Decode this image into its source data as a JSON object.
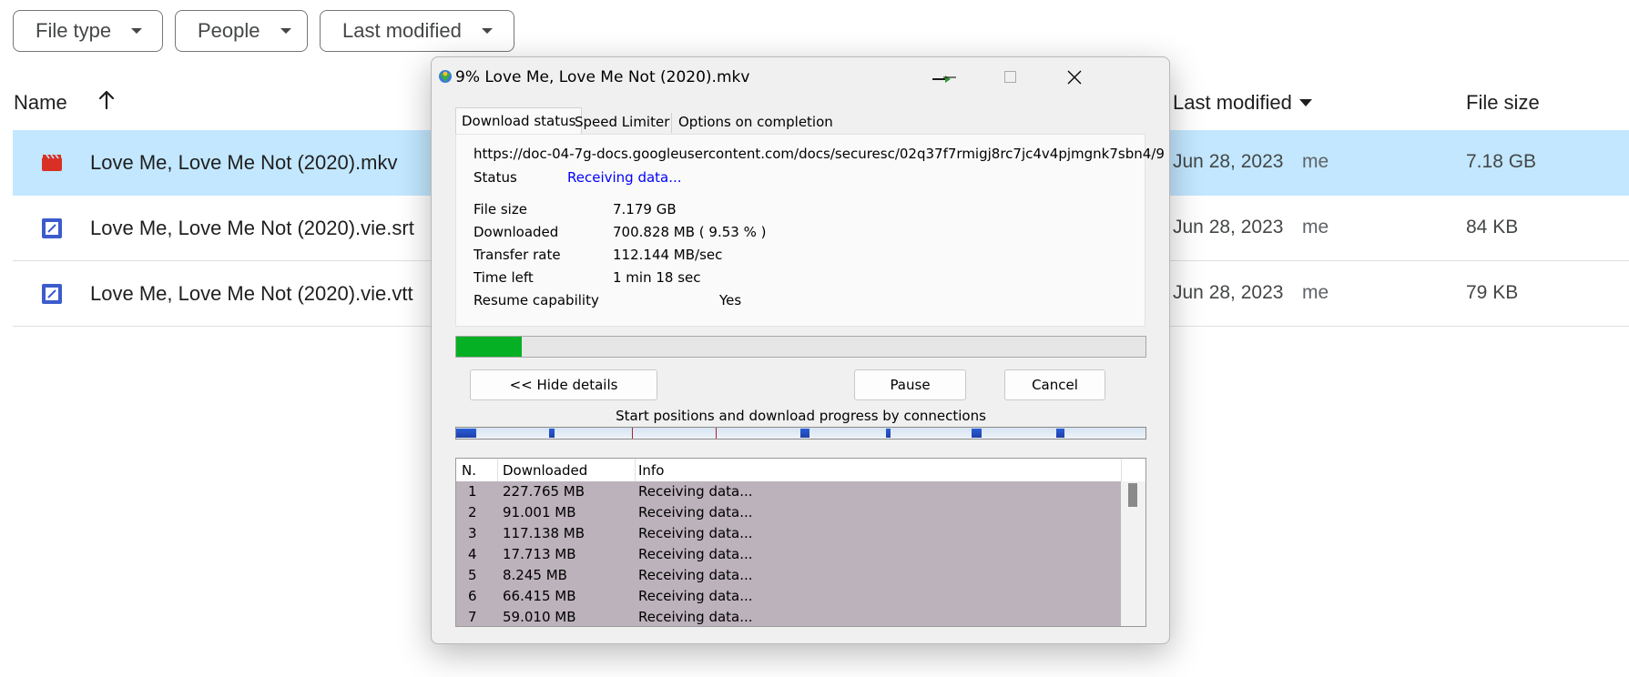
{
  "drive": {
    "filters": [
      "File type",
      "People",
      "Last modified"
    ],
    "columns": {
      "name": "Name",
      "last_modified": "Last modified",
      "file_size": "File size"
    },
    "files": [
      {
        "name": "Love Me, Love Me Not (2020).mkv",
        "date": "Jun 28, 2023",
        "owner": "me",
        "size": "7.18 GB",
        "icon": "video-file-icon",
        "selected": true
      },
      {
        "name": "Love Me, Love Me Not (2020).vie.srt",
        "date": "Jun 28, 2023",
        "owner": "me",
        "size": "84 KB",
        "icon": "document-file-icon",
        "selected": false
      },
      {
        "name": "Love Me, Love Me Not (2020).vie.vtt",
        "date": "Jun 28, 2023",
        "owner": "me",
        "size": "79 KB",
        "icon": "document-file-icon",
        "selected": false
      }
    ]
  },
  "dialog": {
    "title": "9% Love Me, Love Me Not (2020).mkv",
    "tabs": [
      "Download status",
      "Speed Limiter",
      "Options on completion"
    ],
    "url": "https://doc-04-7g-docs.googleusercontent.com/docs/securesc/02q37f7rmigj8rc7jc4v4pjmgnk7sbn4/9",
    "status_label": "Status",
    "status_value": "Receiving data...",
    "details": [
      {
        "label": "File size",
        "value": "7.179  GB"
      },
      {
        "label": "Downloaded",
        "value": "700.828  MB  ( 9.53 % )"
      },
      {
        "label": "Transfer rate",
        "value": "112.144  MB/sec"
      },
      {
        "label": "Time left",
        "value": "1 min 18 sec"
      }
    ],
    "resume_label": "Resume capability",
    "resume_value": "Yes",
    "progress_fraction": 0.0953,
    "buttons": {
      "hide_details": "<< Hide details",
      "pause": "Pause",
      "cancel": "Cancel"
    },
    "connections_title": "Start positions and download progress by connections",
    "table": {
      "headers": [
        "N.",
        "Downloaded",
        "Info"
      ],
      "rows": [
        {
          "n": "1",
          "downloaded": "227.765  MB",
          "info": "Receiving data..."
        },
        {
          "n": "2",
          "downloaded": "91.001  MB",
          "info": "Receiving data..."
        },
        {
          "n": "3",
          "downloaded": "117.138  MB",
          "info": "Receiving data..."
        },
        {
          "n": "4",
          "downloaded": "17.713  MB",
          "info": "Receiving data..."
        },
        {
          "n": "5",
          "downloaded": "8.245  MB",
          "info": "Receiving data..."
        },
        {
          "n": "6",
          "downloaded": "66.415  MB",
          "info": "Receiving data..."
        },
        {
          "n": "7",
          "downloaded": "59.010  MB",
          "info": "Receiving data..."
        }
      ]
    },
    "colors": {
      "progress": "#06b025",
      "status_text": "#0000ff",
      "row_highlight": "#bcb2bb",
      "selected_row": "#c2e7ff"
    }
  }
}
